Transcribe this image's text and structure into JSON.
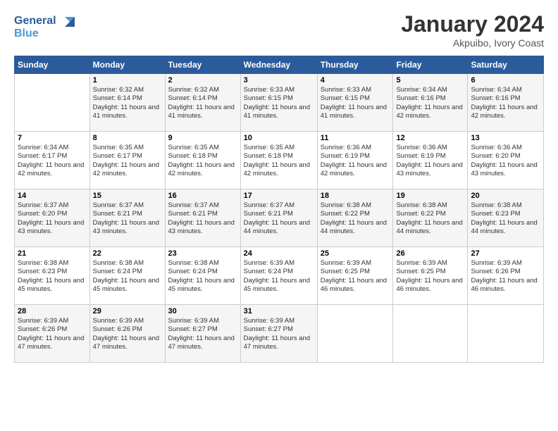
{
  "logo": {
    "line1": "General",
    "line2": "Blue"
  },
  "header": {
    "title": "January 2024",
    "subtitle": "Akpuibo, Ivory Coast"
  },
  "days": [
    "Sunday",
    "Monday",
    "Tuesday",
    "Wednesday",
    "Thursday",
    "Friday",
    "Saturday"
  ],
  "weeks": [
    [
      {
        "date": "",
        "sunrise": "",
        "sunset": "",
        "daylight": ""
      },
      {
        "date": "1",
        "sunrise": "Sunrise: 6:32 AM",
        "sunset": "Sunset: 6:14 PM",
        "daylight": "Daylight: 11 hours and 41 minutes."
      },
      {
        "date": "2",
        "sunrise": "Sunrise: 6:32 AM",
        "sunset": "Sunset: 6:14 PM",
        "daylight": "Daylight: 11 hours and 41 minutes."
      },
      {
        "date": "3",
        "sunrise": "Sunrise: 6:33 AM",
        "sunset": "Sunset: 6:15 PM",
        "daylight": "Daylight: 11 hours and 41 minutes."
      },
      {
        "date": "4",
        "sunrise": "Sunrise: 6:33 AM",
        "sunset": "Sunset: 6:15 PM",
        "daylight": "Daylight: 11 hours and 41 minutes."
      },
      {
        "date": "5",
        "sunrise": "Sunrise: 6:34 AM",
        "sunset": "Sunset: 6:16 PM",
        "daylight": "Daylight: 11 hours and 42 minutes."
      },
      {
        "date": "6",
        "sunrise": "Sunrise: 6:34 AM",
        "sunset": "Sunset: 6:16 PM",
        "daylight": "Daylight: 11 hours and 42 minutes."
      }
    ],
    [
      {
        "date": "7",
        "sunrise": "Sunrise: 6:34 AM",
        "sunset": "Sunset: 6:17 PM",
        "daylight": "Daylight: 11 hours and 42 minutes."
      },
      {
        "date": "8",
        "sunrise": "Sunrise: 6:35 AM",
        "sunset": "Sunset: 6:17 PM",
        "daylight": "Daylight: 11 hours and 42 minutes."
      },
      {
        "date": "9",
        "sunrise": "Sunrise: 6:35 AM",
        "sunset": "Sunset: 6:18 PM",
        "daylight": "Daylight: 11 hours and 42 minutes."
      },
      {
        "date": "10",
        "sunrise": "Sunrise: 6:35 AM",
        "sunset": "Sunset: 6:18 PM",
        "daylight": "Daylight: 11 hours and 42 minutes."
      },
      {
        "date": "11",
        "sunrise": "Sunrise: 6:36 AM",
        "sunset": "Sunset: 6:19 PM",
        "daylight": "Daylight: 11 hours and 42 minutes."
      },
      {
        "date": "12",
        "sunrise": "Sunrise: 6:36 AM",
        "sunset": "Sunset: 6:19 PM",
        "daylight": "Daylight: 11 hours and 43 minutes."
      },
      {
        "date": "13",
        "sunrise": "Sunrise: 6:36 AM",
        "sunset": "Sunset: 6:20 PM",
        "daylight": "Daylight: 11 hours and 43 minutes."
      }
    ],
    [
      {
        "date": "14",
        "sunrise": "Sunrise: 6:37 AM",
        "sunset": "Sunset: 6:20 PM",
        "daylight": "Daylight: 11 hours and 43 minutes."
      },
      {
        "date": "15",
        "sunrise": "Sunrise: 6:37 AM",
        "sunset": "Sunset: 6:21 PM",
        "daylight": "Daylight: 11 hours and 43 minutes."
      },
      {
        "date": "16",
        "sunrise": "Sunrise: 6:37 AM",
        "sunset": "Sunset: 6:21 PM",
        "daylight": "Daylight: 11 hours and 43 minutes."
      },
      {
        "date": "17",
        "sunrise": "Sunrise: 6:37 AM",
        "sunset": "Sunset: 6:21 PM",
        "daylight": "Daylight: 11 hours and 44 minutes."
      },
      {
        "date": "18",
        "sunrise": "Sunrise: 6:38 AM",
        "sunset": "Sunset: 6:22 PM",
        "daylight": "Daylight: 11 hours and 44 minutes."
      },
      {
        "date": "19",
        "sunrise": "Sunrise: 6:38 AM",
        "sunset": "Sunset: 6:22 PM",
        "daylight": "Daylight: 11 hours and 44 minutes."
      },
      {
        "date": "20",
        "sunrise": "Sunrise: 6:38 AM",
        "sunset": "Sunset: 6:23 PM",
        "daylight": "Daylight: 11 hours and 44 minutes."
      }
    ],
    [
      {
        "date": "21",
        "sunrise": "Sunrise: 6:38 AM",
        "sunset": "Sunset: 6:23 PM",
        "daylight": "Daylight: 11 hours and 45 minutes."
      },
      {
        "date": "22",
        "sunrise": "Sunrise: 6:38 AM",
        "sunset": "Sunset: 6:24 PM",
        "daylight": "Daylight: 11 hours and 45 minutes."
      },
      {
        "date": "23",
        "sunrise": "Sunrise: 6:38 AM",
        "sunset": "Sunset: 6:24 PM",
        "daylight": "Daylight: 11 hours and 45 minutes."
      },
      {
        "date": "24",
        "sunrise": "Sunrise: 6:39 AM",
        "sunset": "Sunset: 6:24 PM",
        "daylight": "Daylight: 11 hours and 45 minutes."
      },
      {
        "date": "25",
        "sunrise": "Sunrise: 6:39 AM",
        "sunset": "Sunset: 6:25 PM",
        "daylight": "Daylight: 11 hours and 46 minutes."
      },
      {
        "date": "26",
        "sunrise": "Sunrise: 6:39 AM",
        "sunset": "Sunset: 6:25 PM",
        "daylight": "Daylight: 11 hours and 46 minutes."
      },
      {
        "date": "27",
        "sunrise": "Sunrise: 6:39 AM",
        "sunset": "Sunset: 6:26 PM",
        "daylight": "Daylight: 11 hours and 46 minutes."
      }
    ],
    [
      {
        "date": "28",
        "sunrise": "Sunrise: 6:39 AM",
        "sunset": "Sunset: 6:26 PM",
        "daylight": "Daylight: 11 hours and 47 minutes."
      },
      {
        "date": "29",
        "sunrise": "Sunrise: 6:39 AM",
        "sunset": "Sunset: 6:26 PM",
        "daylight": "Daylight: 11 hours and 47 minutes."
      },
      {
        "date": "30",
        "sunrise": "Sunrise: 6:39 AM",
        "sunset": "Sunset: 6:27 PM",
        "daylight": "Daylight: 11 hours and 47 minutes."
      },
      {
        "date": "31",
        "sunrise": "Sunrise: 6:39 AM",
        "sunset": "Sunset: 6:27 PM",
        "daylight": "Daylight: 11 hours and 47 minutes."
      },
      {
        "date": "",
        "sunrise": "",
        "sunset": "",
        "daylight": ""
      },
      {
        "date": "",
        "sunrise": "",
        "sunset": "",
        "daylight": ""
      },
      {
        "date": "",
        "sunrise": "",
        "sunset": "",
        "daylight": ""
      }
    ]
  ]
}
